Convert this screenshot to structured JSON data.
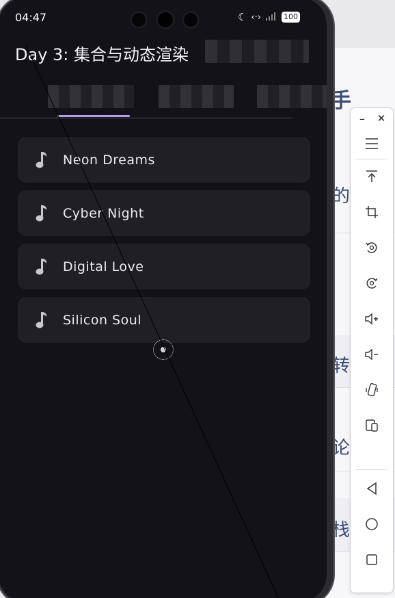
{
  "status_bar": {
    "time": "04:47",
    "battery": "100"
  },
  "app": {
    "title": "Day 3: 集合与动态渲染"
  },
  "songs": [
    {
      "title": "Neon Dreams"
    },
    {
      "title": "Cyber Night"
    },
    {
      "title": "Digital Love"
    },
    {
      "title": "Silicon Soul"
    }
  ],
  "background_doc": {
    "chars": [
      "手",
      "的",
      "转",
      "论",
      "栈"
    ]
  },
  "toolbar": {
    "minimize_label": "–",
    "close_label": "✕",
    "icons": [
      "menu-icon",
      "scroll-top-icon",
      "crop-icon",
      "rotate-left-icon",
      "rotate-right-icon",
      "volume-up-icon",
      "volume-down-icon",
      "shake-icon",
      "devices-icon",
      "back-icon",
      "home-icon",
      "recent-apps-icon"
    ]
  },
  "colors": {
    "screen_bg": "#131218",
    "card_bg": "#211f26",
    "tab_indicator": "#b39df0",
    "doc_text": "#3d4b73"
  }
}
